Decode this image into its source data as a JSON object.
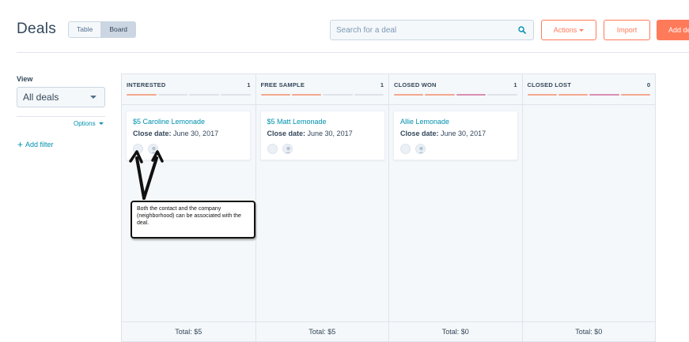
{
  "header": {
    "title": "Deals",
    "view_toggle": {
      "table_label": "Table",
      "board_label": "Board",
      "active": "Board"
    },
    "search": {
      "placeholder": "Search for a deal",
      "value": "",
      "icon": "search-icon"
    },
    "actions_label": "Actions",
    "import_label": "Import",
    "add_label": "Add deal"
  },
  "sidebar": {
    "view_label": "View",
    "view_selected": "All deals",
    "options_label": "Options",
    "add_filter_label": "Add filter"
  },
  "board": {
    "columns": [
      {
        "title": "INTERESTED",
        "count": "1",
        "total": "Total: $5",
        "deals": [
          {
            "name": "$5 Caroline Lemonade",
            "close_label": "Close date:",
            "close_date": "June 30, 2017"
          }
        ]
      },
      {
        "title": "FREE SAMPLE",
        "count": "1",
        "total": "Total: $5",
        "deals": [
          {
            "name": "$5 Matt Lemonade",
            "close_label": "Close date:",
            "close_date": "June 30, 2017"
          }
        ]
      },
      {
        "title": "CLOSED WON",
        "count": "1",
        "total": "Total: $0",
        "deals": [
          {
            "name": "Allie Lemonade",
            "close_label": "Close date:",
            "close_date": "June 30, 2017"
          }
        ]
      },
      {
        "title": "CLOSED LOST",
        "count": "0",
        "total": "Total: $0",
        "deals": []
      }
    ]
  },
  "annotation": {
    "text": "Both the contact and the company (neighborhood) can be associated with the deal."
  },
  "colors": {
    "accent": "#ff7a59",
    "link": "#0091ae",
    "text": "#33475b",
    "stage_orange": "#f2a88f",
    "stage_pink": "#d88fb1",
    "stage_grey": "#dfe3eb"
  }
}
